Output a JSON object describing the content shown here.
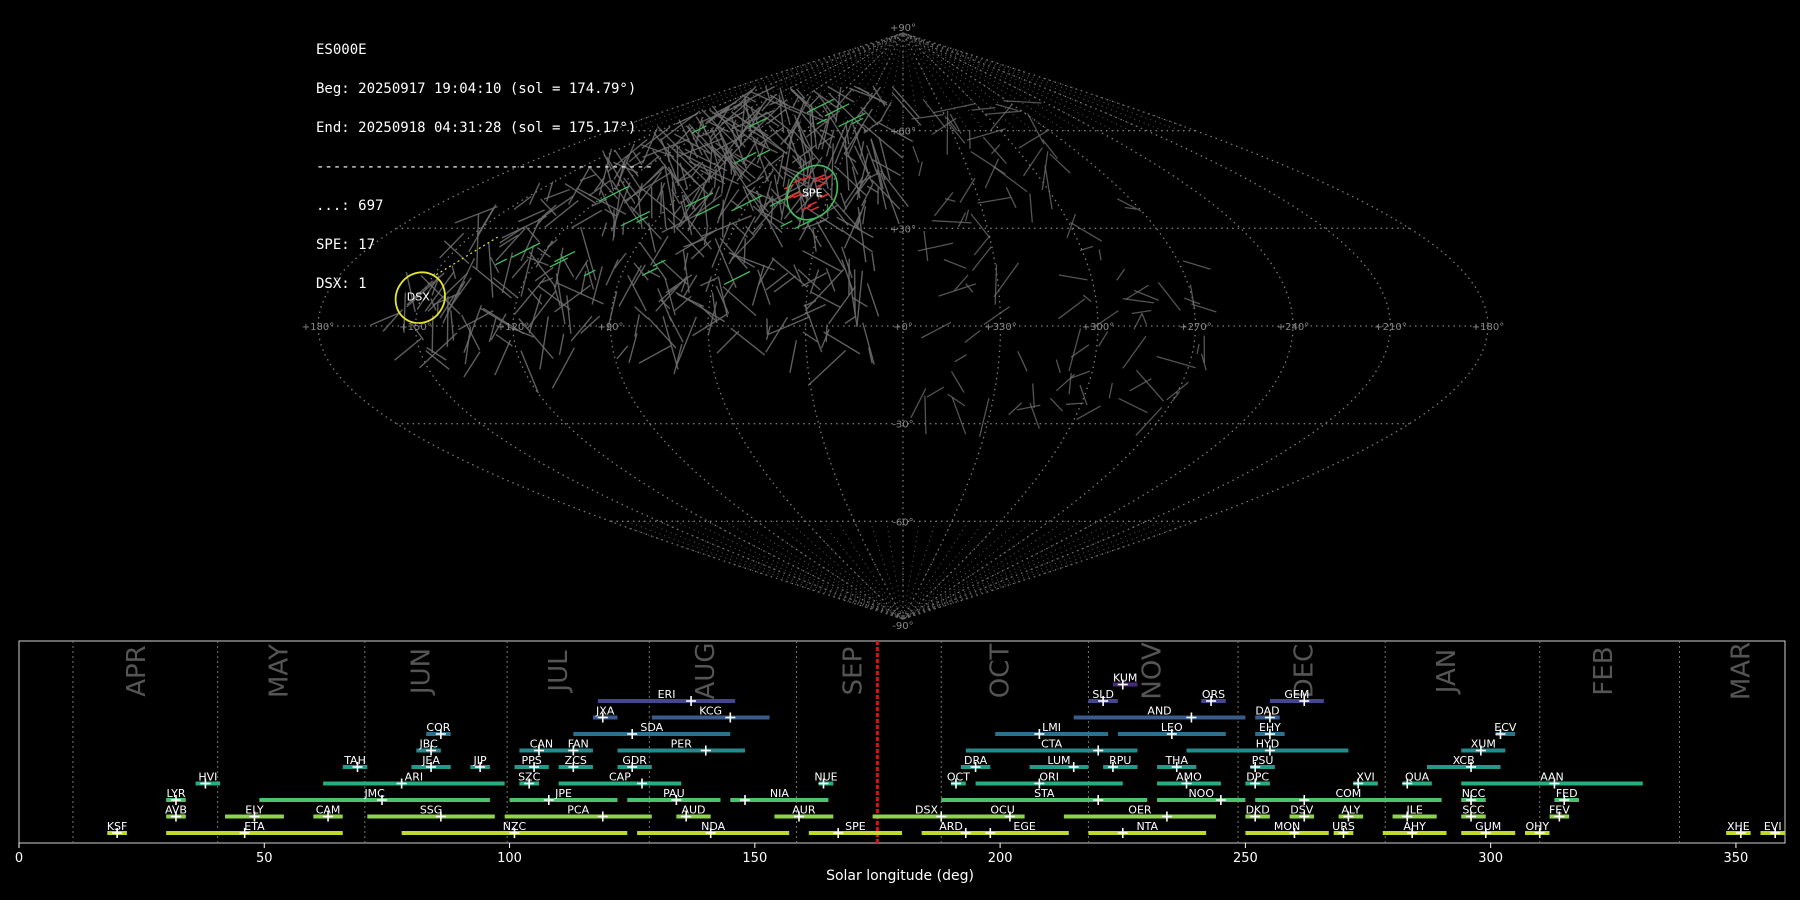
{
  "info": {
    "station": "ES000E",
    "beg": "Beg: 20250917 19:04:10 (sol = 174.79°)",
    "end": "End: 20250918 04:31:28 (sol = 175.17°)",
    "separator": "----------------------------------------",
    "counts": [
      {
        "code": "...",
        "text": "...: 697"
      },
      {
        "code": "SPE",
        "text": "SPE: 17"
      },
      {
        "code": "DSX",
        "text": "DSX: 1"
      }
    ]
  },
  "skymap": {
    "projection": "sinusoidal",
    "lon_labels": [
      "+180°",
      "+150°",
      "+120°",
      "+90°",
      "+0°",
      "+330°",
      "+300°",
      "+270°",
      "+240°",
      "+210°",
      "+180°"
    ],
    "lat_labels": [
      "+90°",
      "+60°",
      "+30°",
      "0°",
      "-30°",
      "-60°",
      "-90°"
    ],
    "highlights": [
      {
        "code": "SPE",
        "lon": 37,
        "lat": 41,
        "color": "#3fbf5f"
      },
      {
        "code": "DSX",
        "lon": 151,
        "lat": 9,
        "color": "#e6e632"
      }
    ],
    "colors": {
      "background": "#000000",
      "sporadic": "#707070",
      "grid": "#7a7a7a",
      "spe_ring": "#3fbf5f",
      "dsx_ring": "#e6e632",
      "spe_points": "#e03030"
    }
  },
  "chart_data": {
    "type": "timeline",
    "xlabel": "Solar longitude (deg)",
    "xlim": [
      0,
      360
    ],
    "xticks": [
      0,
      50,
      100,
      150,
      200,
      250,
      300,
      350
    ],
    "current_sol": 174.98,
    "month_boundaries": [
      11,
      40.5,
      70.5,
      99.5,
      128.5,
      158.5,
      188,
      218,
      248.5,
      278.5,
      310,
      338.5
    ],
    "months": [
      {
        "label": "APR",
        "sol": 25
      },
      {
        "label": "MAY",
        "sol": 54
      },
      {
        "label": "JUN",
        "sol": 83
      },
      {
        "label": "JUL",
        "sol": 111
      },
      {
        "label": "AUG",
        "sol": 141
      },
      {
        "label": "SEP",
        "sol": 171
      },
      {
        "label": "OCT",
        "sol": 201
      },
      {
        "label": "NOV",
        "sol": 232
      },
      {
        "label": "DEC",
        "sol": 263
      },
      {
        "label": "JAN",
        "sol": 292
      },
      {
        "label": "FEB",
        "sol": 324
      },
      {
        "label": "MAR",
        "sol": 352
      }
    ],
    "showers": [
      {
        "code": "KSF",
        "start": 18,
        "end": 22,
        "peak": 20,
        "row": 0
      },
      {
        "code": "ETA",
        "start": 30,
        "end": 66,
        "peak": 46,
        "row": 0
      },
      {
        "code": "NZC",
        "start": 78,
        "end": 124,
        "peak": 101,
        "row": 0
      },
      {
        "code": "NDA",
        "start": 126,
        "end": 157,
        "peak": 141,
        "row": 0
      },
      {
        "code": "SPE",
        "start": 161,
        "end": 180,
        "peak": 167,
        "row": 0
      },
      {
        "code": "ARD",
        "start": 184,
        "end": 196,
        "peak": 193,
        "row": 0
      },
      {
        "code": "EGE",
        "start": 196,
        "end": 214,
        "peak": 198,
        "row": 0
      },
      {
        "code": "NTA",
        "start": 218,
        "end": 242,
        "peak": 225,
        "row": 0
      },
      {
        "code": "MON",
        "start": 250,
        "end": 267,
        "peak": 260,
        "row": 0
      },
      {
        "code": "URS",
        "start": 268,
        "end": 272,
        "peak": 270,
        "row": 0
      },
      {
        "code": "AHY",
        "start": 278,
        "end": 291,
        "peak": 284,
        "row": 0
      },
      {
        "code": "GUM",
        "start": 294,
        "end": 305,
        "peak": 299,
        "row": 0
      },
      {
        "code": "OHY",
        "start": 307,
        "end": 312,
        "peak": 310,
        "row": 0
      },
      {
        "code": "XHE",
        "start": 348,
        "end": 353,
        "peak": 351,
        "row": 0
      },
      {
        "code": "EVI",
        "start": 355,
        "end": 360,
        "peak": 358,
        "row": 0
      },
      {
        "code": "AVB",
        "start": 30,
        "end": 34,
        "peak": 32,
        "row": 1
      },
      {
        "code": "ELY",
        "start": 42,
        "end": 54,
        "peak": 48,
        "row": 1
      },
      {
        "code": "CAM",
        "start": 60,
        "end": 66,
        "peak": 63,
        "row": 1
      },
      {
        "code": "SSG",
        "start": 71,
        "end": 97,
        "peak": 86,
        "row": 1
      },
      {
        "code": "PCA",
        "start": 99,
        "end": 129,
        "peak": 119,
        "row": 1
      },
      {
        "code": "AUD",
        "start": 134,
        "end": 141,
        "peak": 136,
        "row": 1
      },
      {
        "code": "AUR",
        "start": 154,
        "end": 166,
        "peak": 159,
        "row": 1
      },
      {
        "code": "DSX",
        "start": 174,
        "end": 196,
        "peak": 188,
        "row": 1
      },
      {
        "code": "OCU",
        "start": 196,
        "end": 205,
        "peak": 202,
        "row": 1
      },
      {
        "code": "OER",
        "start": 213,
        "end": 244,
        "peak": 234,
        "row": 1
      },
      {
        "code": "DKD",
        "start": 250,
        "end": 255,
        "peak": 252,
        "row": 1
      },
      {
        "code": "DSV",
        "start": 259,
        "end": 264,
        "peak": 262,
        "row": 1
      },
      {
        "code": "ALY",
        "start": 269,
        "end": 274,
        "peak": 271,
        "row": 1
      },
      {
        "code": "JLE",
        "start": 280,
        "end": 289,
        "peak": 283,
        "row": 1
      },
      {
        "code": "SCC",
        "start": 294,
        "end": 299,
        "peak": 296,
        "row": 1
      },
      {
        "code": "FEV",
        "start": 312,
        "end": 316,
        "peak": 314,
        "row": 1
      },
      {
        "code": "LYR",
        "start": 30,
        "end": 34,
        "peak": 32,
        "row": 2
      },
      {
        "code": "JMC",
        "start": 49,
        "end": 96,
        "peak": 74,
        "row": 2
      },
      {
        "code": "JPE",
        "start": 100,
        "end": 122,
        "peak": 108,
        "row": 2
      },
      {
        "code": "PAU",
        "start": 124,
        "end": 143,
        "peak": 134,
        "row": 2
      },
      {
        "code": "NIA",
        "start": 145,
        "end": 165,
        "peak": 148,
        "row": 2
      },
      {
        "code": "STA",
        "start": 188,
        "end": 230,
        "peak": 220,
        "row": 2
      },
      {
        "code": "NOO",
        "start": 232,
        "end": 250,
        "peak": 245,
        "row": 2
      },
      {
        "code": "COM",
        "start": 252,
        "end": 290,
        "peak": 262,
        "row": 2
      },
      {
        "code": "NCC",
        "start": 294,
        "end": 299,
        "peak": 296,
        "row": 2
      },
      {
        "code": "FED",
        "start": 313,
        "end": 318,
        "peak": 315,
        "row": 2
      },
      {
        "code": "HVI",
        "start": 36,
        "end": 41,
        "peak": 38,
        "row": 3
      },
      {
        "code": "ARI",
        "start": 62,
        "end": 99,
        "peak": 78,
        "row": 3
      },
      {
        "code": "SZC",
        "start": 102,
        "end": 106,
        "peak": 104,
        "row": 3
      },
      {
        "code": "CAP",
        "start": 110,
        "end": 135,
        "peak": 127,
        "row": 3
      },
      {
        "code": "NUE",
        "start": 163,
        "end": 166,
        "peak": 164,
        "row": 3
      },
      {
        "code": "OCT",
        "start": 190,
        "end": 193,
        "peak": 191,
        "row": 3
      },
      {
        "code": "ORI",
        "start": 195,
        "end": 225,
        "peak": 208,
        "row": 3
      },
      {
        "code": "AMO",
        "start": 232,
        "end": 245,
        "peak": 238,
        "row": 3
      },
      {
        "code": "DPC",
        "start": 250,
        "end": 255,
        "peak": 252,
        "row": 3
      },
      {
        "code": "XVI",
        "start": 272,
        "end": 277,
        "peak": 273,
        "row": 3
      },
      {
        "code": "QUA",
        "start": 282,
        "end": 288,
        "peak": 283,
        "row": 3
      },
      {
        "code": "AAN",
        "start": 294,
        "end": 331,
        "peak": 313,
        "row": 3
      },
      {
        "code": "TAH",
        "start": 66,
        "end": 71,
        "peak": 69,
        "row": 4
      },
      {
        "code": "JEA",
        "start": 80,
        "end": 88,
        "peak": 84,
        "row": 4
      },
      {
        "code": "JIP",
        "start": 92,
        "end": 96,
        "peak": 94,
        "row": 4
      },
      {
        "code": "PPS",
        "start": 101,
        "end": 108,
        "peak": 105,
        "row": 4
      },
      {
        "code": "ZCS",
        "start": 110,
        "end": 117,
        "peak": 113,
        "row": 4
      },
      {
        "code": "GDR",
        "start": 122,
        "end": 129,
        "peak": 125,
        "row": 4
      },
      {
        "code": "DRA",
        "start": 192,
        "end": 198,
        "peak": 195,
        "row": 4
      },
      {
        "code": "LUM",
        "start": 206,
        "end": 218,
        "peak": 215,
        "row": 4
      },
      {
        "code": "RPU",
        "start": 221,
        "end": 228,
        "peak": 223,
        "row": 4
      },
      {
        "code": "THA",
        "start": 232,
        "end": 240,
        "peak": 236,
        "row": 4
      },
      {
        "code": "PSU",
        "start": 251,
        "end": 256,
        "peak": 252,
        "row": 4
      },
      {
        "code": "XCB",
        "start": 287,
        "end": 302,
        "peak": 296,
        "row": 4
      },
      {
        "code": "JBC",
        "start": 81,
        "end": 86,
        "peak": 84,
        "row": 5
      },
      {
        "code": "CAN",
        "start": 102,
        "end": 111,
        "peak": 106,
        "row": 5
      },
      {
        "code": "FAN",
        "start": 111,
        "end": 117,
        "peak": 113,
        "row": 5
      },
      {
        "code": "PER",
        "start": 122,
        "end": 148,
        "peak": 140,
        "row": 5
      },
      {
        "code": "CTA",
        "start": 193,
        "end": 228,
        "peak": 220,
        "row": 5
      },
      {
        "code": "HYD",
        "start": 238,
        "end": 271,
        "peak": 255,
        "row": 5
      },
      {
        "code": "XUM",
        "start": 294,
        "end": 303,
        "peak": 298,
        "row": 5
      },
      {
        "code": "COR",
        "start": 83,
        "end": 88,
        "peak": 86,
        "row": 6
      },
      {
        "code": "SDA",
        "start": 113,
        "end": 145,
        "peak": 125,
        "row": 6
      },
      {
        "code": "LMI",
        "start": 199,
        "end": 222,
        "peak": 208,
        "row": 6
      },
      {
        "code": "LEO",
        "start": 224,
        "end": 246,
        "peak": 235,
        "row": 6
      },
      {
        "code": "EHY",
        "start": 252,
        "end": 258,
        "peak": 255,
        "row": 6
      },
      {
        "code": "ECV",
        "start": 301,
        "end": 305,
        "peak": 302,
        "row": 6
      },
      {
        "code": "JXA",
        "start": 117,
        "end": 122,
        "peak": 119,
        "row": 7
      },
      {
        "code": "KCG",
        "start": 129,
        "end": 153,
        "peak": 145,
        "row": 7
      },
      {
        "code": "AND",
        "start": 215,
        "end": 250,
        "peak": 239,
        "row": 7
      },
      {
        "code": "DAD",
        "start": 252,
        "end": 257,
        "peak": 255,
        "row": 7
      },
      {
        "code": "ERI",
        "start": 118,
        "end": 146,
        "peak": 137,
        "row": 8
      },
      {
        "code": "SLD",
        "start": 218,
        "end": 224,
        "peak": 221,
        "row": 8
      },
      {
        "code": "ORS",
        "start": 241,
        "end": 246,
        "peak": 243,
        "row": 8
      },
      {
        "code": "GEM",
        "start": 255,
        "end": 266,
        "peak": 262,
        "row": 8
      },
      {
        "code": "KUM",
        "start": 223,
        "end": 228,
        "peak": 225,
        "row": 9
      }
    ],
    "row_colors": [
      "#c0d830",
      "#8fd34a",
      "#4cc26c",
      "#27ad81",
      "#21998b",
      "#238a8d",
      "#2c728e",
      "#3b5b8c",
      "#44478a",
      "#482a7a"
    ]
  }
}
